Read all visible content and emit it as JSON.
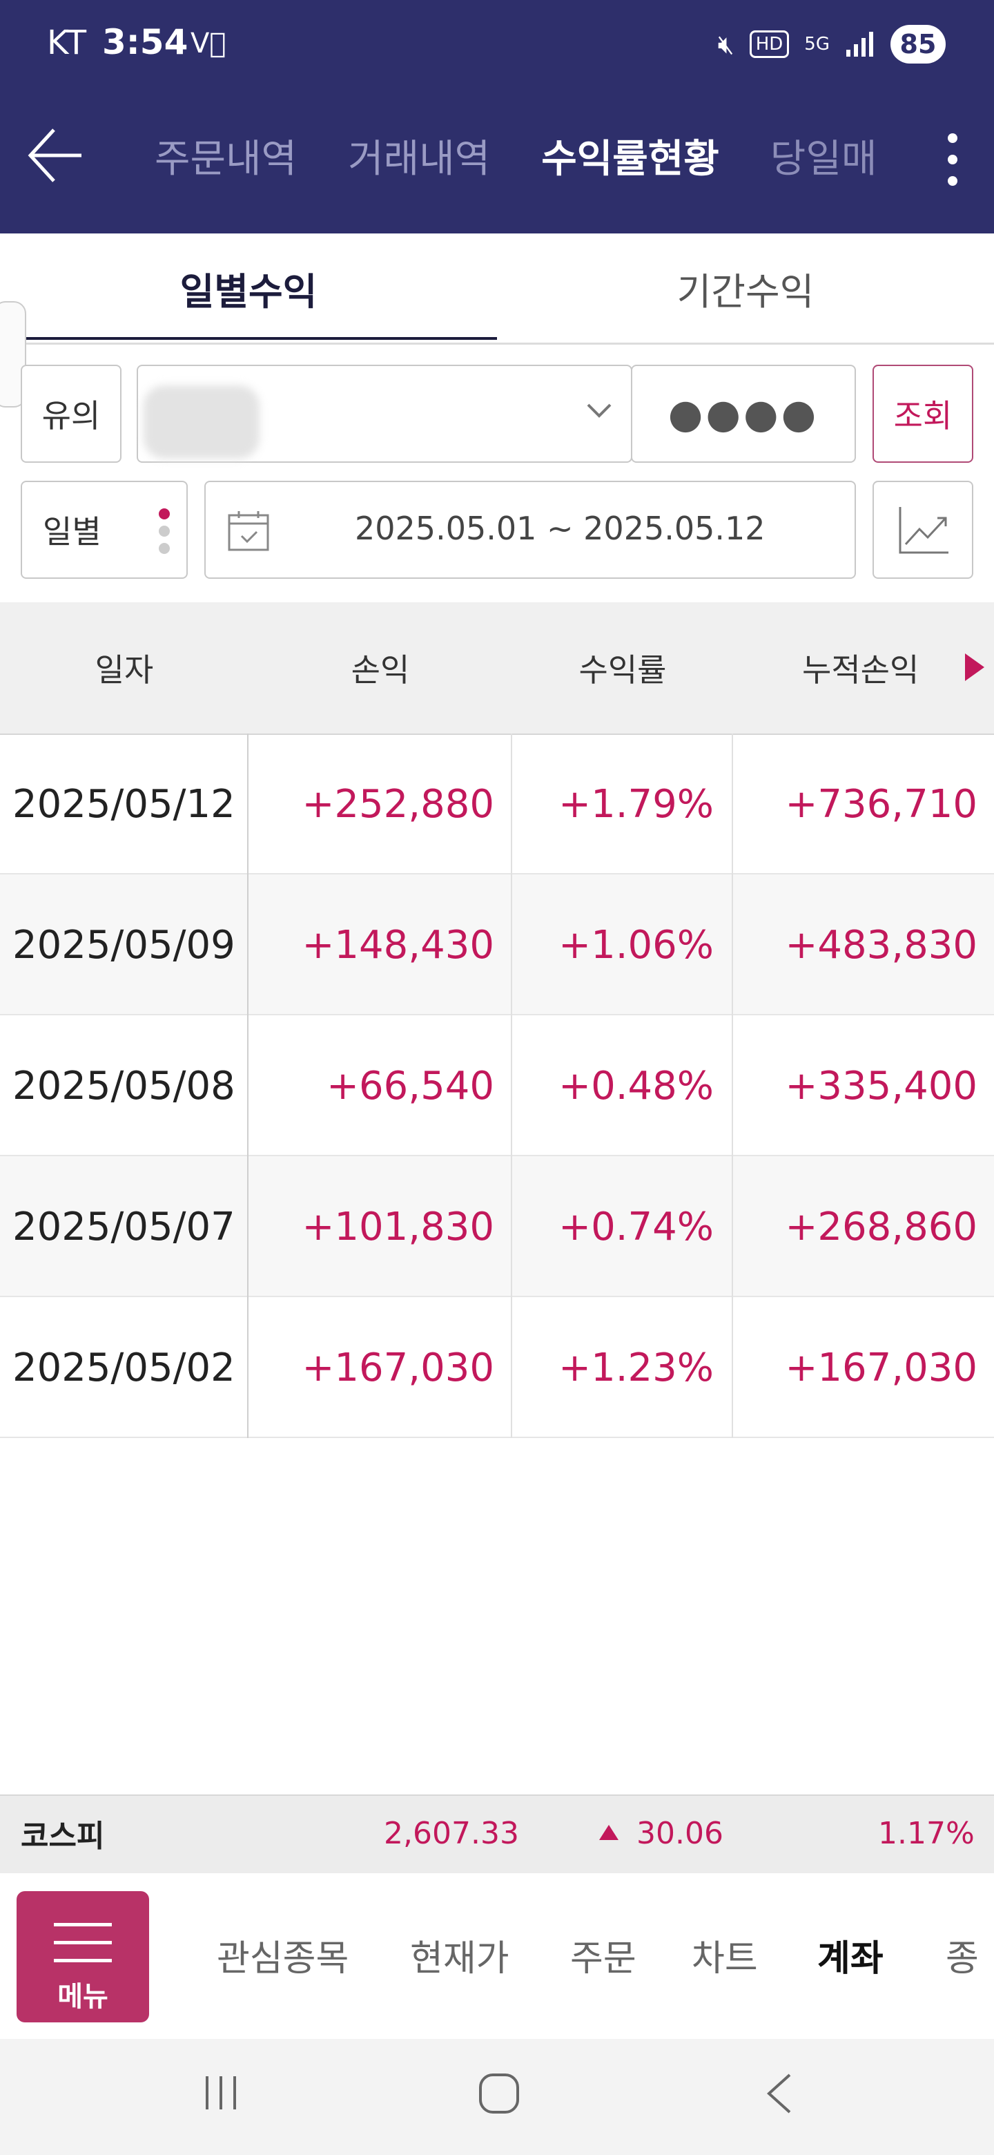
{
  "status_bar": {
    "carrier": "KT",
    "time": "3:54",
    "battery": "85"
  },
  "header": {
    "tabs": [
      {
        "label": "주문내역"
      },
      {
        "label": "거래내역"
      },
      {
        "label": "수익률현황"
      },
      {
        "label": "당일매"
      }
    ],
    "active_tab": "수익률현황"
  },
  "subtabs": [
    {
      "label": "일별수익"
    },
    {
      "label": "기간수익"
    }
  ],
  "filters": {
    "account_type_label": "유의",
    "password_mask": "●●●●",
    "query_button": "조회",
    "period_type": "일별",
    "date_range": "2025.05.01 ~ 2025.05.12"
  },
  "table": {
    "headers": [
      "일자",
      "손익",
      "수익률",
      "누적손익"
    ],
    "rows": [
      {
        "date": "2025/05/12",
        "pnl": "+252,880",
        "rate": "+1.79%",
        "cumulative": "+736,710"
      },
      {
        "date": "2025/05/09",
        "pnl": "+148,430",
        "rate": "+1.06%",
        "cumulative": "+483,830"
      },
      {
        "date": "2025/05/08",
        "pnl": "+66,540",
        "rate": "+0.48%",
        "cumulative": "+335,400"
      },
      {
        "date": "2025/05/07",
        "pnl": "+101,830",
        "rate": "+0.74%",
        "cumulative": "+268,860"
      },
      {
        "date": "2025/05/02",
        "pnl": "+167,030",
        "rate": "+1.23%",
        "cumulative": "+167,030"
      }
    ]
  },
  "ticker": {
    "name": "코스피",
    "value": "2,607.33",
    "change": "30.06",
    "change_rate": "1.17%"
  },
  "bottom_nav": {
    "menu_label": "메뉴",
    "items": [
      {
        "label": "관심종목"
      },
      {
        "label": "현재가"
      },
      {
        "label": "주문"
      },
      {
        "label": "차트"
      },
      {
        "label": "계좌"
      },
      {
        "label": "종"
      }
    ],
    "active": "계좌"
  },
  "colors": {
    "header_bg": "#2e2f6b",
    "accent": "#c2185b",
    "menu_bg": "#b83267"
  }
}
